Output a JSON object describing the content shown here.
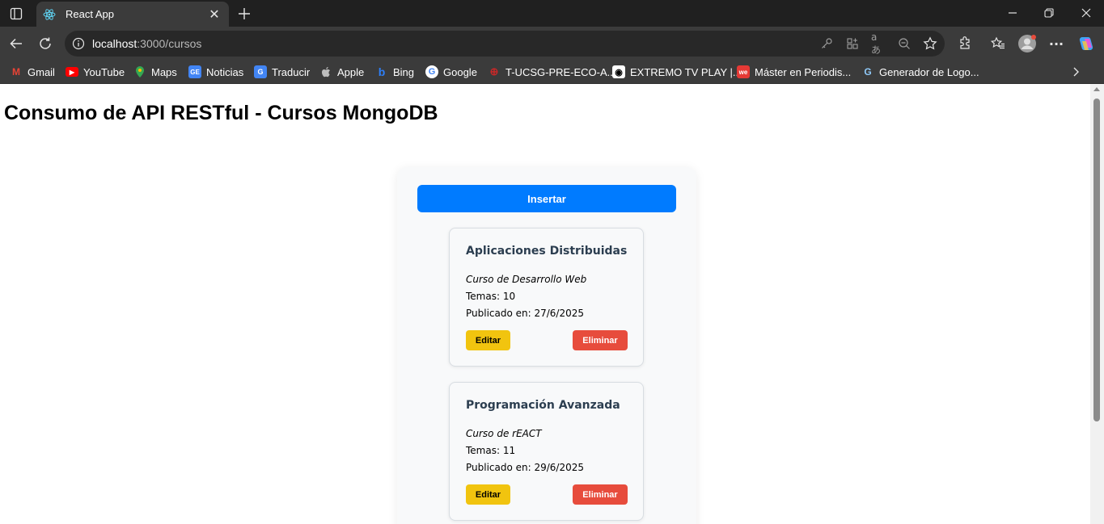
{
  "browser": {
    "tab_title": "React App",
    "url_host": "localhost",
    "url_path": ":3000/cursos",
    "bookmarks": [
      {
        "label": "Gmail",
        "icon": "gmail-icon",
        "color": "#ea4335",
        "glyph": "M"
      },
      {
        "label": "YouTube",
        "icon": "youtube-icon",
        "color": "#ff0000",
        "glyph": "▶"
      },
      {
        "label": "Maps",
        "icon": "maps-icon",
        "color": "#34a853",
        "glyph": "●"
      },
      {
        "label": "Noticias",
        "icon": "news-icon",
        "color": "#4285f4",
        "glyph": "G"
      },
      {
        "label": "Traducir",
        "icon": "translate-icon",
        "color": "#4285f4",
        "glyph": "G"
      },
      {
        "label": "Apple",
        "icon": "apple-icon",
        "color": "#bdbdbd",
        "glyph": ""
      },
      {
        "label": "Bing",
        "icon": "bing-icon",
        "color": "#2d7ff9",
        "glyph": "b"
      },
      {
        "label": "Google",
        "icon": "google-icon",
        "color": "#ffffff",
        "glyph": "G"
      },
      {
        "label": "T-UCSG-PRE-ECO-A...",
        "icon": "ucsg-icon",
        "color": "#c62828",
        "glyph": "⊕"
      },
      {
        "label": "EXTREMO TV PLAY |...",
        "icon": "extremo-tv-icon",
        "color": "#ffffff",
        "glyph": "◉"
      },
      {
        "label": "Máster en Periodis...",
        "icon": "master-icon",
        "color": "#e53935",
        "glyph": "we"
      },
      {
        "label": "Generador de Logo...",
        "icon": "logo-generator-icon",
        "color": "#90caf9",
        "glyph": "G"
      }
    ]
  },
  "page": {
    "title": "Consumo de API RESTful - Cursos MongoDB",
    "insert_label": "Insertar",
    "edit_label": "Editar",
    "delete_label": "Eliminar",
    "courses": [
      {
        "name": "Aplicaciones Distribuidas",
        "description": "Curso de Desarrollo Web",
        "topics": "Temas: 10",
        "published": "Publicado en: 27/6/2025"
      },
      {
        "name": "Programación Avanzada",
        "description": "Curso de rEACT",
        "topics": "Temas: 11",
        "published": "Publicado en: 29/6/2025"
      }
    ]
  },
  "colors": {
    "insert_button": "#007bff",
    "edit_button": "#f1c40f",
    "delete_button": "#e74c3c",
    "card_title": "#2c3e50"
  }
}
